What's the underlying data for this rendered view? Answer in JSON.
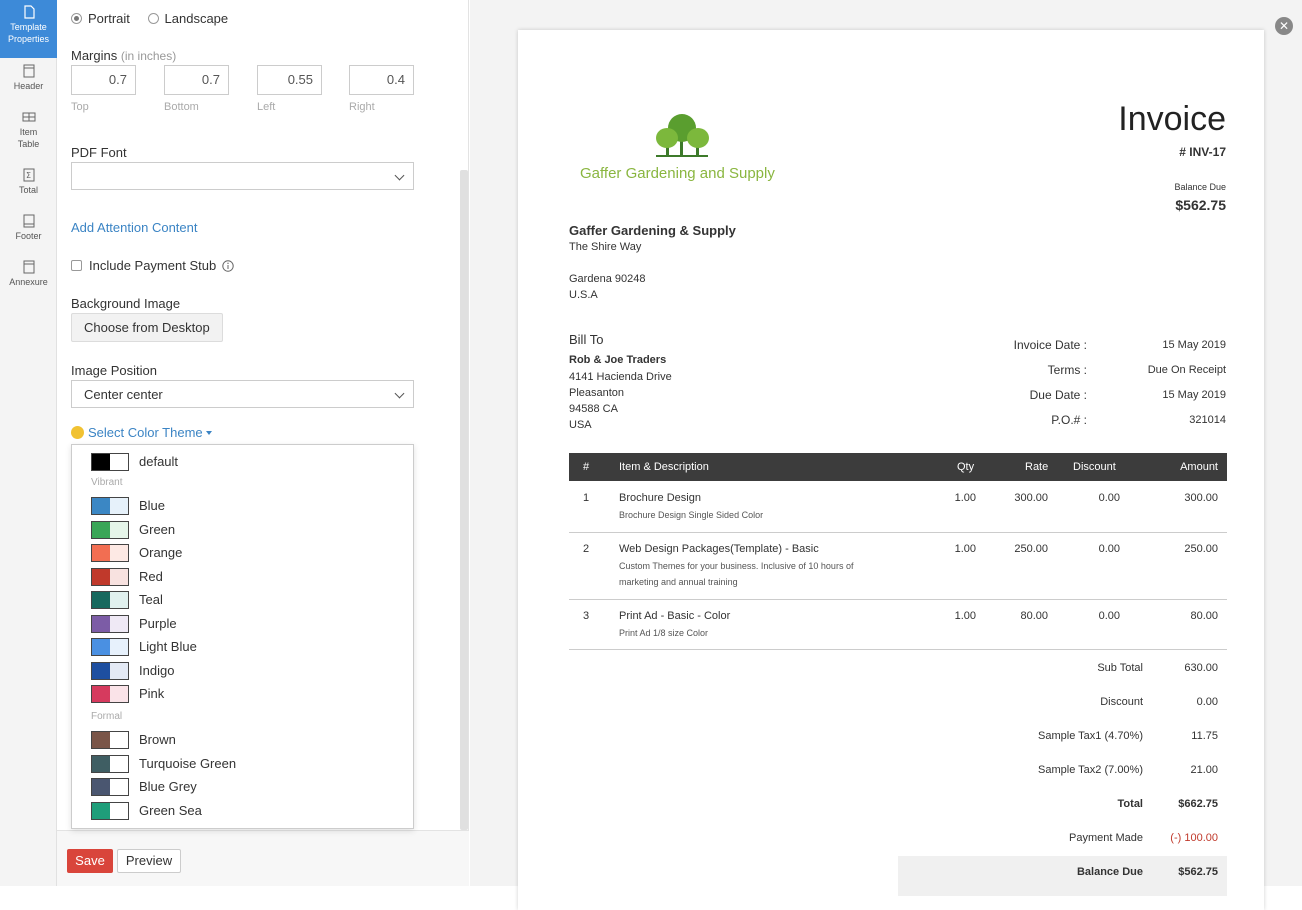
{
  "rail": {
    "items": [
      {
        "label": "Template Properties"
      },
      {
        "label": "Header"
      },
      {
        "label": "Item Table"
      },
      {
        "label": "Total"
      },
      {
        "label": "Footer"
      },
      {
        "label": "Annexure"
      }
    ]
  },
  "panel": {
    "orientation": {
      "portrait": "Portrait",
      "landscape": "Landscape",
      "selected": "Portrait"
    },
    "margins": {
      "label": "Margins",
      "unit": "(in inches)",
      "top": {
        "value": "0.7",
        "caption": "Top"
      },
      "bottom": {
        "value": "0.7",
        "caption": "Bottom"
      },
      "left": {
        "value": "0.55",
        "caption": "Left"
      },
      "right": {
        "value": "0.4",
        "caption": "Right"
      }
    },
    "pdf_font": {
      "label": "PDF Font",
      "value": ""
    },
    "attention_link": "Add Attention Content",
    "payment_stub": {
      "label": "Include Payment Stub",
      "checked": false
    },
    "background_image": {
      "label": "Background Image",
      "button": "Choose from Desktop"
    },
    "image_position": {
      "label": "Image Position",
      "value": "Center center"
    },
    "color_theme": {
      "link": "Select Color Theme",
      "default": {
        "name": "default",
        "a": "#000000",
        "b": "#ffffff"
      },
      "group_vibrant": "Vibrant",
      "vibrant": [
        {
          "name": "Blue",
          "a": "#3b87c4",
          "b": "#e6f1fa"
        },
        {
          "name": "Green",
          "a": "#3aa657",
          "b": "#e5f5e9"
        },
        {
          "name": "Orange",
          "a": "#f26e52",
          "b": "#fde9e4"
        },
        {
          "name": "Red",
          "a": "#c0392b",
          "b": "#f8e2e0"
        },
        {
          "name": "Teal",
          "a": "#17695e",
          "b": "#e0f0ee"
        },
        {
          "name": "Purple",
          "a": "#7c5ca6",
          "b": "#efe9f5"
        },
        {
          "name": "Light Blue",
          "a": "#4a90e2",
          "b": "#e7f1fc"
        },
        {
          "name": "Indigo",
          "a": "#1e4fa0",
          "b": "#e4eaf5"
        },
        {
          "name": "Pink",
          "a": "#d63a5e",
          "b": "#fae3e8"
        }
      ],
      "group_formal": "Formal",
      "formal": [
        {
          "name": "Brown",
          "a": "#7a5548",
          "b": "#ffffff"
        },
        {
          "name": "Turquoise Green",
          "a": "#3f5e63",
          "b": "#ffffff"
        },
        {
          "name": "Blue Grey",
          "a": "#4a5670",
          "b": "#ffffff"
        },
        {
          "name": "Green Sea",
          "a": "#1f9e7a",
          "b": "#ffffff"
        }
      ]
    },
    "save": "Save",
    "preview": "Preview"
  },
  "invoice": {
    "logo_text": "Gaffer Gardening and Supply",
    "title": "Invoice",
    "number": "# INV-17",
    "balance_due_label": "Balance Due",
    "balance_due_value": "$562.75",
    "company": {
      "name": "Gaffer Gardening & Supply",
      "line1": "The Shire Way",
      "line2": "Gardena  90248",
      "line3": "U.S.A"
    },
    "bill_to": {
      "label": "Bill To",
      "name": "Rob & Joe Traders",
      "line1": "4141 Hacienda Drive",
      "line2": "Pleasanton",
      "line3": "94588 CA",
      "line4": "USA"
    },
    "meta": [
      {
        "label": "Invoice Date :",
        "value": "15 May 2019"
      },
      {
        "label": "Terms :",
        "value": "Due On Receipt"
      },
      {
        "label": "Due Date :",
        "value": "15 May 2019"
      },
      {
        "label": "P.O.# :",
        "value": "321014"
      }
    ],
    "table_headers": {
      "num": "#",
      "item": "Item & Description",
      "qty": "Qty",
      "rate": "Rate",
      "discount": "Discount",
      "amount": "Amount"
    },
    "items": [
      {
        "num": "1",
        "name": "Brochure Design",
        "desc1": "Brochure Design Single Sided Color",
        "desc2": "",
        "qty": "1.00",
        "rate": "300.00",
        "discount": "0.00",
        "amount": "300.00"
      },
      {
        "num": "2",
        "name": "Web Design Packages(Template) - Basic",
        "desc1": "Custom Themes for your business. Inclusive of 10 hours of",
        "desc2": "marketing and annual training",
        "qty": "1.00",
        "rate": "250.00",
        "discount": "0.00",
        "amount": "250.00"
      },
      {
        "num": "3",
        "name": "Print Ad - Basic - Color",
        "desc1": "Print Ad 1/8 size Color",
        "desc2": "",
        "qty": "1.00",
        "rate": "80.00",
        "discount": "0.00",
        "amount": "80.00"
      }
    ],
    "totals": [
      {
        "label": "Sub Total",
        "value": "630.00"
      },
      {
        "label": "Discount",
        "value": "0.00"
      },
      {
        "label": "Sample Tax1 (4.70%)",
        "value": "11.75"
      },
      {
        "label": "Sample Tax2 (7.00%)",
        "value": "21.00"
      },
      {
        "label": "Total",
        "value": "$662.75"
      },
      {
        "label": "Payment Made",
        "value": "(-) 100.00"
      },
      {
        "label": "Balance Due",
        "value": "$562.75"
      }
    ],
    "close_icon": "close-icon"
  }
}
